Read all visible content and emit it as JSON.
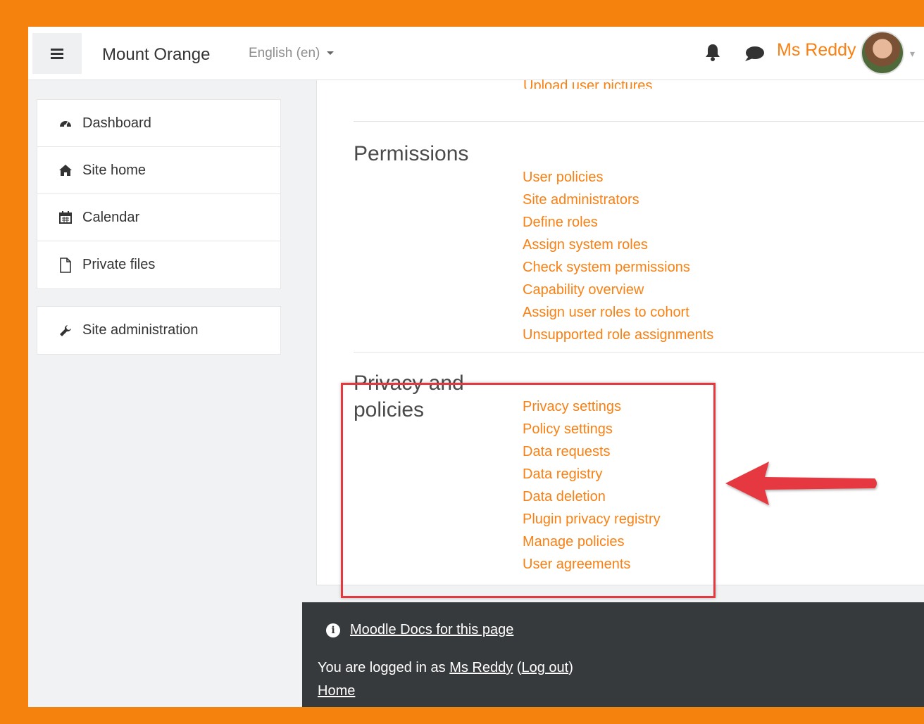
{
  "navbar": {
    "site_name": "Mount Orange",
    "language": "English (en)",
    "user_name": "Ms Reddy"
  },
  "sidebar": {
    "items": [
      {
        "label": "Dashboard",
        "icon": "dashboard-icon"
      },
      {
        "label": "Site home",
        "icon": "home-icon"
      },
      {
        "label": "Calendar",
        "icon": "calendar-icon"
      },
      {
        "label": "Private files",
        "icon": "file-icon"
      }
    ],
    "admin": {
      "label": "Site administration",
      "icon": "wrench-icon"
    }
  },
  "main": {
    "cut_off_link": "Upload user pictures",
    "permissions": {
      "title": "Permissions",
      "links": [
        "User policies",
        "Site administrators",
        "Define roles",
        "Assign system roles",
        "Check system permissions",
        "Capability overview",
        "Assign user roles to cohort",
        "Unsupported role assignments"
      ]
    },
    "privacy": {
      "title_line1": "Privacy and",
      "title_line2": "policies",
      "links": [
        "Privacy settings",
        "Policy settings",
        "Data requests",
        "Data registry",
        "Data deletion",
        "Plugin privacy registry",
        "Manage policies",
        "User agreements"
      ]
    }
  },
  "footer": {
    "docs_link": "Moodle Docs for this page",
    "logged_in_prefix": "You are logged in as ",
    "logged_in_user": "Ms Reddy",
    "logout_open": "(",
    "logout_label": "Log out",
    "logout_close": ")",
    "home_link": "Home"
  },
  "colors": {
    "accent": "#f98012",
    "frame": "#f5820d",
    "highlight": "#e53940",
    "footer_bg": "#373a3c"
  }
}
